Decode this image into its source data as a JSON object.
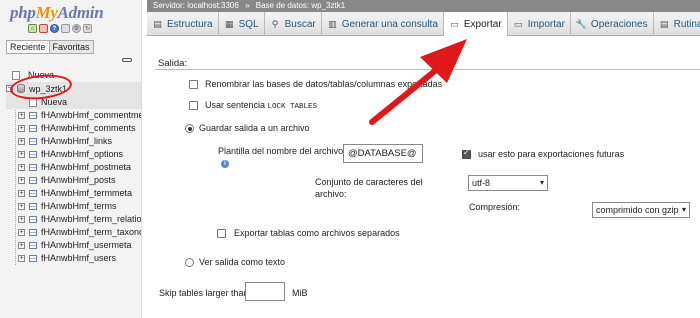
{
  "nav": {
    "logo": {
      "php": "php",
      "my": "My",
      "admin": "Admin"
    },
    "tabs": [
      "Reciente",
      "Favoritas"
    ],
    "tree": {
      "new_root": "Nueva",
      "db": "wp_3ztk1",
      "new_table": "Nueva",
      "tables": [
        "fHAnwbHmf_commentmeta",
        "fHAnwbHmf_comments",
        "fHAnwbHmf_links",
        "fHAnwbHmf_options",
        "fHAnwbHmf_postmeta",
        "fHAnwbHmf_posts",
        "fHAnwbHmf_termmeta",
        "fHAnwbHmf_terms",
        "fHAnwbHmf_term_relationship",
        "fHAnwbHmf_term_taxonomy",
        "fHAnwbHmf_usermeta",
        "fHAnwbHmf_users"
      ]
    }
  },
  "breadcrumb": {
    "server": "Servidor: localhost:3306",
    "separator": "»",
    "database": "Base de datos: wp_3ztk1"
  },
  "tabs": [
    {
      "label": "Estructura",
      "icon": "structure-icon"
    },
    {
      "label": "SQL",
      "icon": "sql-icon"
    },
    {
      "label": "Buscar",
      "icon": "search-icon"
    },
    {
      "label": "Generar una consulta",
      "icon": "query-icon"
    },
    {
      "label": "Exportar",
      "icon": "export-icon",
      "active": true
    },
    {
      "label": "Importar",
      "icon": "import-icon"
    },
    {
      "label": "Operaciones",
      "icon": "wrench-icon"
    },
    {
      "label": "Rutinas",
      "icon": "routines-icon"
    }
  ],
  "export": {
    "section_title": "Salida:",
    "rename_label": "Renombrar las bases de datos/tablas/columnas exportadas",
    "lock_label_prefix": "Usar sentencia",
    "lock_label_code": "LOCK TABLES",
    "save_file_label": "Guardar salida a un archivo",
    "template_label": "Plantilla del nombre del archivo:",
    "template_value": "@DATABASE@",
    "remember_label": "usar esto para exportaciones futuras",
    "charset_label": "Conjunto de caracteres del archivo:",
    "charset_value": "utf-8",
    "compression_label": "Compresión:",
    "compression_value": "comprimido con gzip",
    "separate_files_label": "Exportar tablas como archivos separados",
    "view_text_label": "Ver salida como texto",
    "skip_label": "Skip tables larger than",
    "skip_value": "",
    "skip_unit": "MiB"
  },
  "colors": {
    "annotation_red": "#e0181b",
    "link_blue": "#235a81",
    "breadcrumb_bg": "#888888"
  }
}
